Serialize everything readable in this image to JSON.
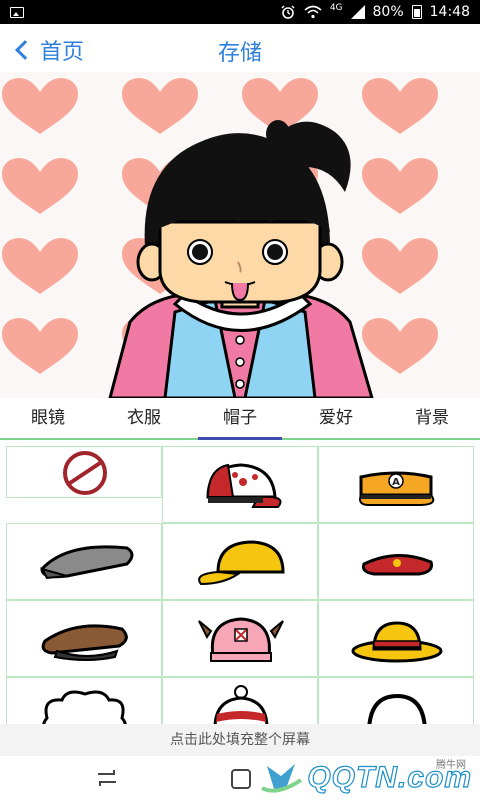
{
  "status_bar": {
    "network": "4G",
    "battery": "80%",
    "time": "14:48"
  },
  "header": {
    "back_label": "首页",
    "title": "存储"
  },
  "tabs": [
    {
      "label": "眼镜",
      "active": false
    },
    {
      "label": "衣服",
      "active": false
    },
    {
      "label": "帽子",
      "active": true
    },
    {
      "label": "爱好",
      "active": false
    },
    {
      "label": "背景",
      "active": false
    }
  ],
  "hats": [
    {
      "name": "none"
    },
    {
      "name": "baseball-cap-white-red"
    },
    {
      "name": "orange-cap-letter",
      "letter": "A"
    },
    {
      "name": "gray-flat-cap"
    },
    {
      "name": "yellow-cap"
    },
    {
      "name": "red-beret"
    },
    {
      "name": "brown-newsboy-cap"
    },
    {
      "name": "pink-chopper-hat"
    },
    {
      "name": "straw-hat"
    },
    {
      "name": "white-fluffy-hat"
    },
    {
      "name": "knit-beanie"
    },
    {
      "name": "headphones"
    }
  ],
  "bottom": {
    "fill_screen_label": "点击此处填充整个屏幕"
  },
  "watermark": {
    "brand": "QQTN.com",
    "small": "腾牛网"
  },
  "colors": {
    "accent": "#2f7fdc",
    "tab_underline": "#3e4db0",
    "divider": "#7ed28a",
    "heart": "#f8a89a"
  }
}
